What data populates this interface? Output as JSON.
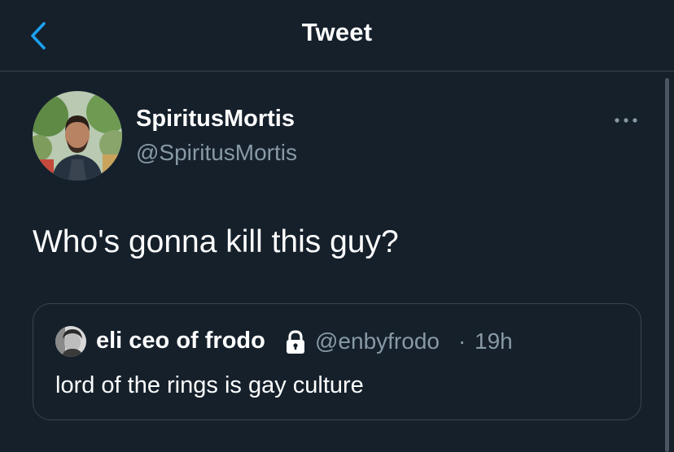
{
  "header": {
    "title": "Tweet",
    "back_icon": "chevron-left-icon"
  },
  "colors": {
    "background": "#15202b",
    "accent": "#1da1f2",
    "secondary_text": "#8899a6",
    "border": "#38444d"
  },
  "tweet": {
    "display_name": "SpiritusMortis",
    "handle": "@SpiritusMortis",
    "text": "Who's gonna kill this guy?",
    "more_icon": "more-horizontal-icon",
    "quoted": {
      "display_name": "eli ceo of frodo",
      "lock_icon": "lock-icon",
      "handle": "@enbyfrodo",
      "separator": "·",
      "time": "19h",
      "text": "lord of the rings is gay culture"
    }
  }
}
